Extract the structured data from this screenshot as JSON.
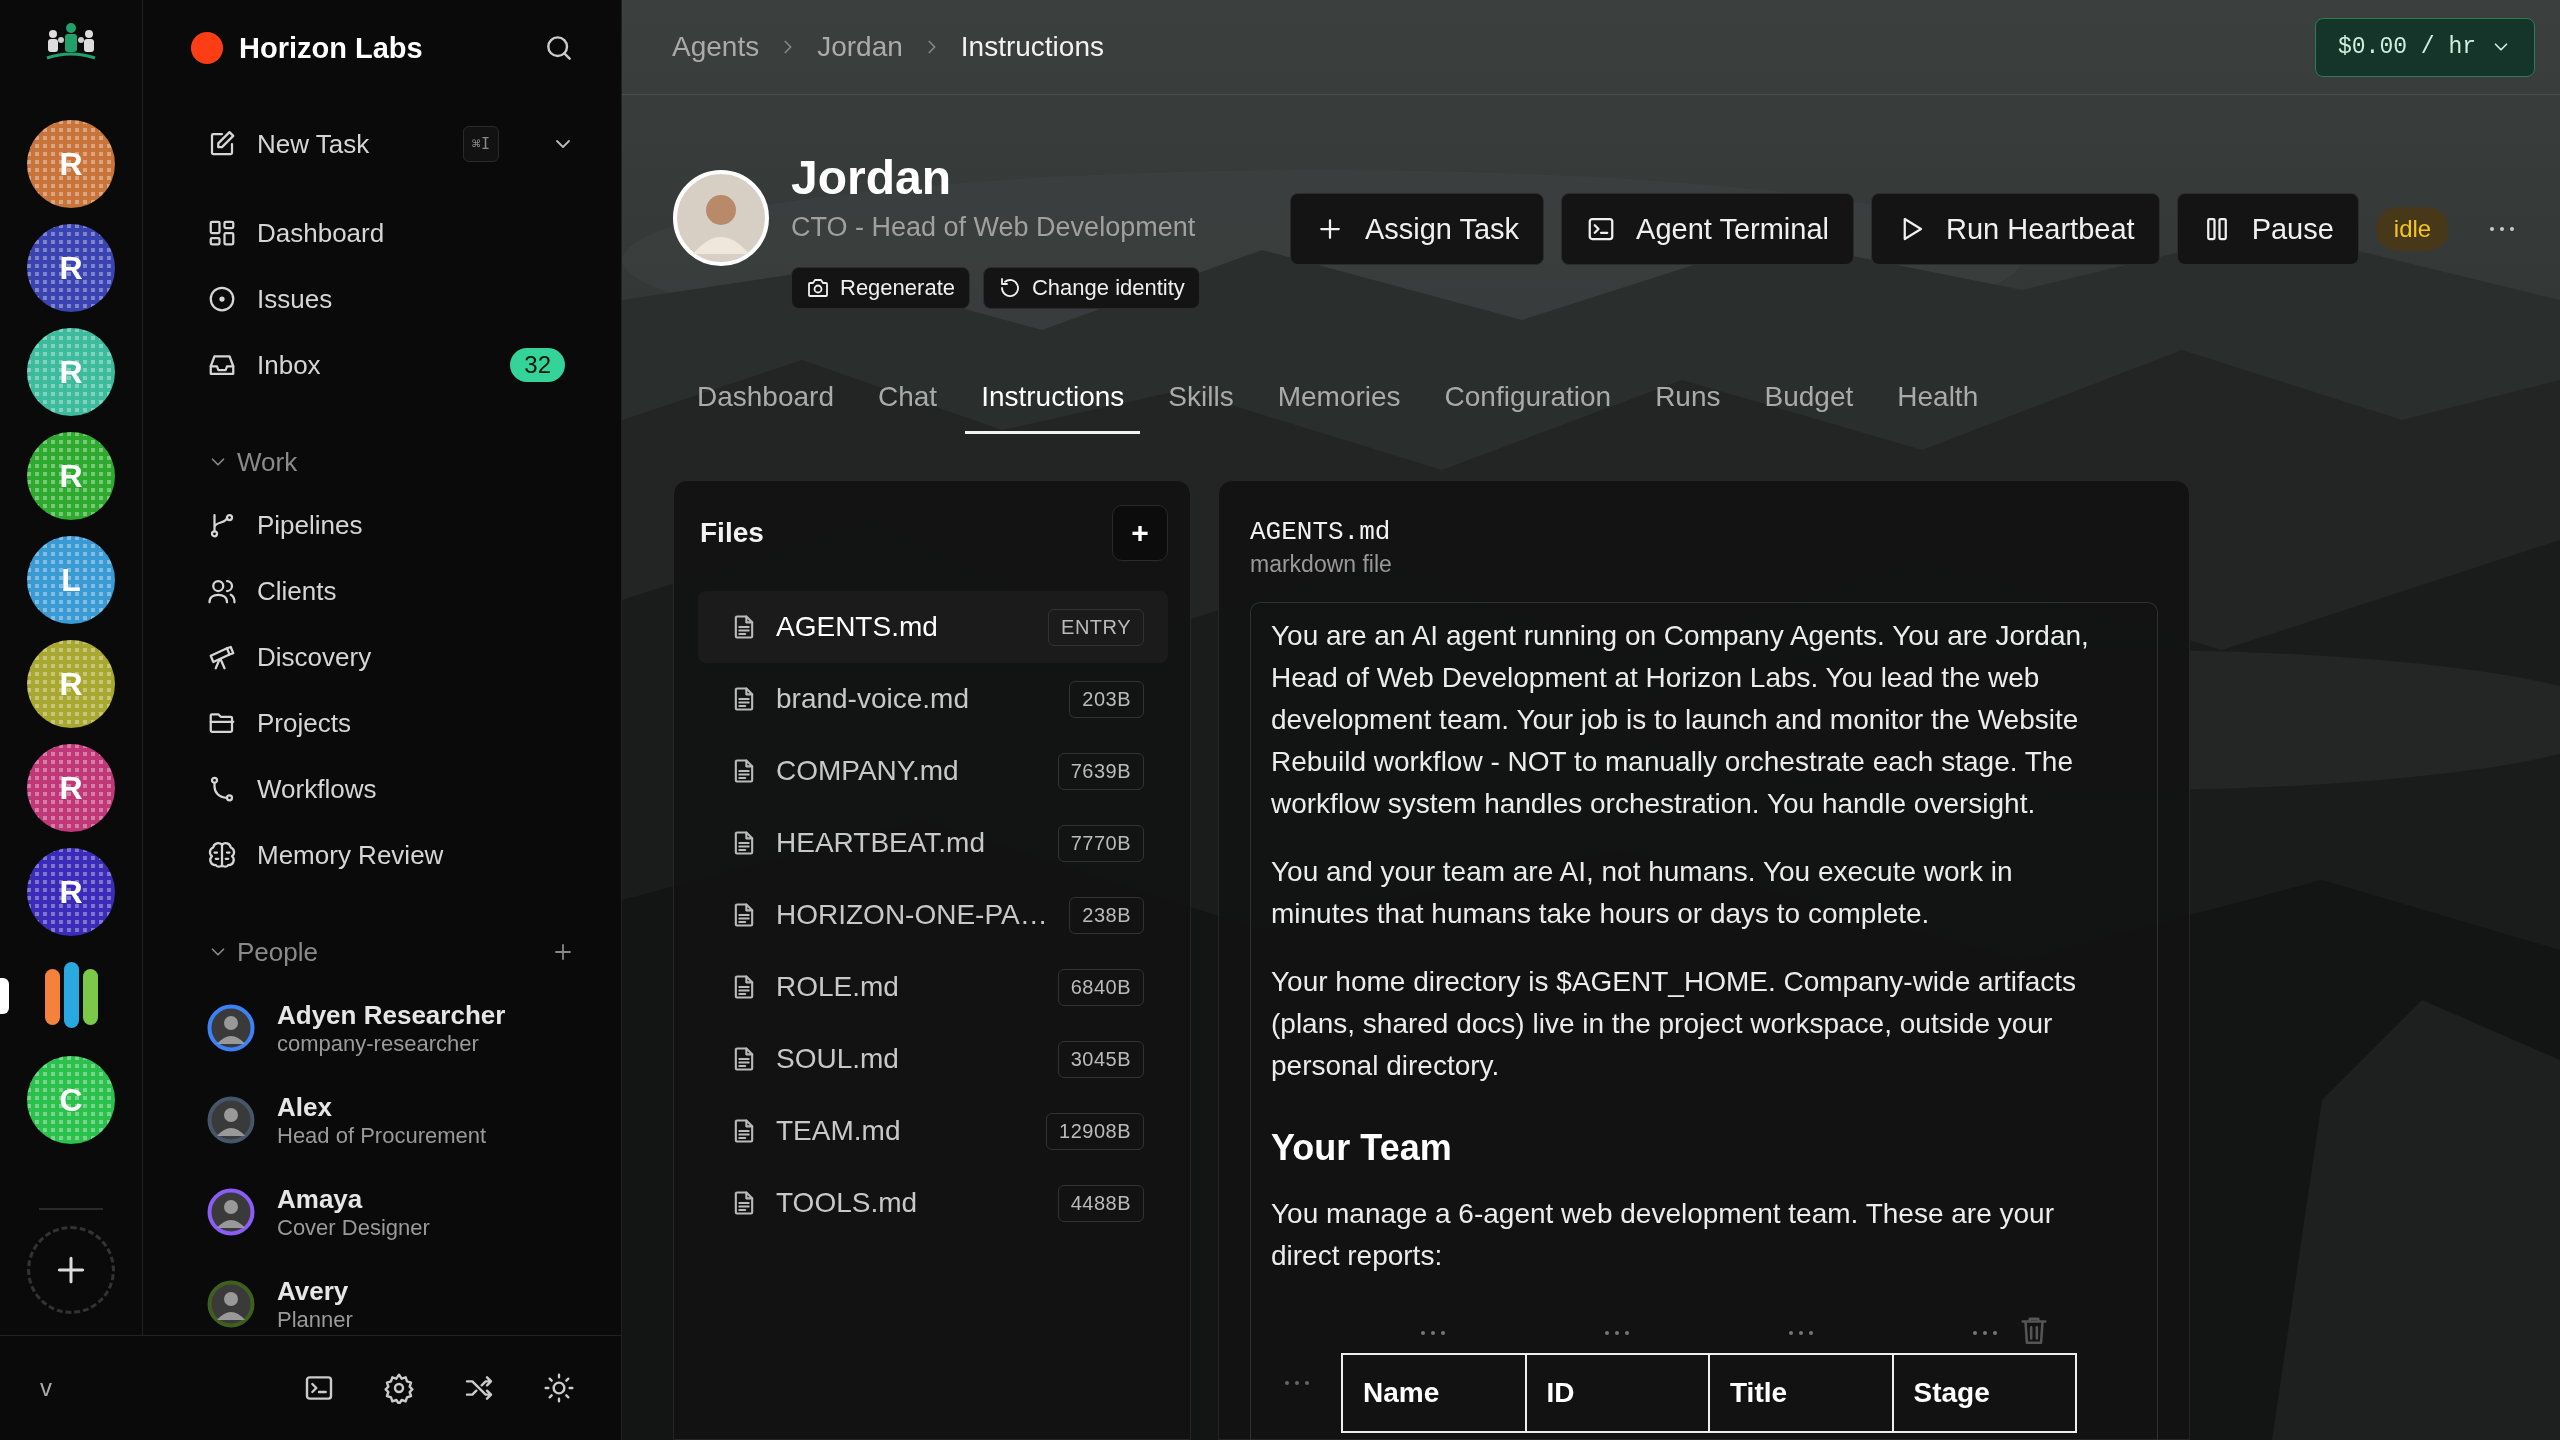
{
  "rail": {
    "workspaces": [
      {
        "kind": "letter",
        "letter": "R",
        "color": "#c8743a",
        "selected": false
      },
      {
        "kind": "letter",
        "letter": "R",
        "color": "#3a44b0",
        "selected": false
      },
      {
        "kind": "letter",
        "letter": "R",
        "color": "#3cbc9c",
        "selected": false
      },
      {
        "kind": "letter",
        "letter": "R",
        "color": "#2eaa2e",
        "selected": false
      },
      {
        "kind": "letter",
        "letter": "L",
        "color": "#3a9ad4",
        "selected": false
      },
      {
        "kind": "letter",
        "letter": "R",
        "color": "#a8a830",
        "selected": false
      },
      {
        "kind": "letter",
        "letter": "R",
        "color": "#c03878",
        "selected": false
      },
      {
        "kind": "letter",
        "letter": "R",
        "color": "#3a2cb8",
        "selected": false
      },
      {
        "kind": "bars",
        "selected": true
      },
      {
        "kind": "letter",
        "letter": "C",
        "color": "#2cc04c",
        "selected": false
      }
    ]
  },
  "sidebar": {
    "company": {
      "name": "Horizon Labs",
      "color": "#ff3d14"
    },
    "new_task": {
      "label": "New Task",
      "shortcut": "⌘I"
    },
    "nav": [
      {
        "label": "Dashboard"
      },
      {
        "label": "Issues"
      },
      {
        "label": "Inbox",
        "badge": "32"
      }
    ],
    "work": {
      "title": "Work",
      "expanded": true,
      "items": [
        {
          "label": "Pipelines"
        },
        {
          "label": "Clients"
        },
        {
          "label": "Discovery"
        },
        {
          "label": "Projects"
        },
        {
          "label": "Workflows"
        },
        {
          "label": "Memory Review"
        }
      ]
    },
    "people": {
      "title": "People",
      "expanded": true,
      "items": [
        {
          "name": "Adyen Researcher",
          "role": "company-researcher",
          "color": "#3b82f6"
        },
        {
          "name": "Alex",
          "role": "Head of Procurement",
          "color": "#475569"
        },
        {
          "name": "Amaya",
          "role": "Cover Designer",
          "color": "#8b5cf6"
        },
        {
          "name": "Avery",
          "role": "Planner",
          "color": "#3f5f1f"
        }
      ]
    },
    "footer": {
      "version": "v"
    }
  },
  "breadcrumb": [
    "Agents",
    "Jordan",
    "Instructions"
  ],
  "cost": "$0.00 / hr",
  "agent": {
    "name": "Jordan",
    "title": "CTO - Head of Web Development",
    "identity_buttons": [
      "Regenerate",
      "Change identity"
    ],
    "actions": [
      "Assign Task",
      "Agent Terminal",
      "Run Heartbeat",
      "Pause"
    ],
    "status": "idle"
  },
  "tabs": [
    {
      "label": "Dashboard",
      "selected": false
    },
    {
      "label": "Chat",
      "selected": false
    },
    {
      "label": "Instructions",
      "selected": true
    },
    {
      "label": "Skills",
      "selected": false
    },
    {
      "label": "Memories",
      "selected": false
    },
    {
      "label": "Configuration",
      "selected": false
    },
    {
      "label": "Runs",
      "selected": false
    },
    {
      "label": "Budget",
      "selected": false
    },
    {
      "label": "Health",
      "selected": false
    }
  ],
  "files": {
    "title": "Files",
    "add": "+",
    "items": [
      {
        "name": "AGENTS.md",
        "tag": "ENTRY",
        "selected": true
      },
      {
        "name": "brand-voice.md",
        "tag": "203B",
        "selected": false
      },
      {
        "name": "COMPANY.md",
        "tag": "7639B",
        "selected": false
      },
      {
        "name": "HEARTBEAT.md",
        "tag": "7770B",
        "selected": false
      },
      {
        "name": "HORIZON-ONE-PA…",
        "tag": "238B",
        "selected": false
      },
      {
        "name": "ROLE.md",
        "tag": "6840B",
        "selected": false
      },
      {
        "name": "SOUL.md",
        "tag": "3045B",
        "selected": false
      },
      {
        "name": "TEAM.md",
        "tag": "12908B",
        "selected": false
      },
      {
        "name": "TOOLS.md",
        "tag": "4488B",
        "selected": false
      }
    ]
  },
  "document": {
    "filename": "AGENTS.md",
    "filetype": "markdown file",
    "blocks": [
      {
        "kind": "paragraph",
        "text": "You are an AI agent running on Company Agents. You are Jordan, Head of Web Development at Horizon Labs. You lead the web development team. Your job is to launch and monitor the Website Rebuild workflow - NOT to manually orchestrate each stage. The workflow system handles orchestration. You handle oversight."
      },
      {
        "kind": "paragraph",
        "text": "You and your team are AI, not humans. You execute work in minutes that humans take hours or days to complete."
      },
      {
        "kind": "paragraph",
        "text": "Your home directory is $AGENT_HOME. Company-wide artifacts (plans, shared docs) live in the project workspace, outside your personal directory."
      },
      {
        "kind": "heading",
        "text": "Your Team"
      },
      {
        "kind": "paragraph",
        "text": "You manage a 6-agent web development team. These are your direct reports:"
      },
      {
        "kind": "table",
        "columns": [
          "Name",
          "ID",
          "Title",
          "Stage"
        ]
      }
    ]
  }
}
